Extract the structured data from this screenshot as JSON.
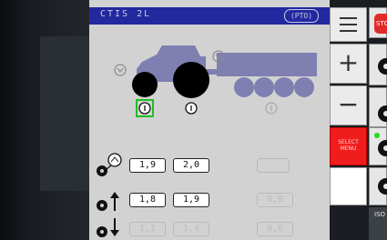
{
  "screen": {
    "title": "CTIS 2L",
    "pto_badge": "(PTO)"
  },
  "current_pressure_row": {
    "icon": "gauge-icon",
    "values": [
      "1,9",
      "2,0"
    ]
  },
  "increase_row": {
    "icon": "arrow-up-icon",
    "values": [
      "1,8",
      "1,9",
      "0,0"
    ]
  },
  "decrease_row": {
    "icon": "arrow-down-icon",
    "values": [
      "1,1",
      "1,4",
      "0,0"
    ]
  },
  "softkeys": {
    "menu_icon": "hamburger-menu-icon",
    "plus_label": "+",
    "minus_label": "−",
    "red_label_line1": "SELECT",
    "red_label_line2": "MENU"
  },
  "right_panel": {
    "stop_label": "STO",
    "iso_label": "ISO"
  },
  "colors": {
    "title_bar": "#22299f",
    "vehicle": "#7f7fb1",
    "selected_axle": "#1fbf1f",
    "alert_key": "#f01d1d"
  }
}
